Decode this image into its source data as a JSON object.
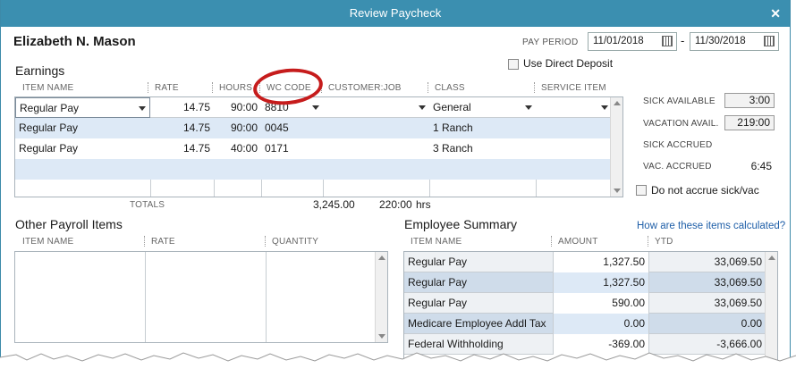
{
  "window": {
    "title": "Review Paycheck"
  },
  "employee": {
    "name": "Elizabeth N. Mason"
  },
  "pay_period": {
    "label": "PAY PERIOD",
    "from": "11/01/2018",
    "dash": "-",
    "to": "11/30/2018"
  },
  "direct_deposit": {
    "label": "Use Direct Deposit",
    "checked": false
  },
  "earnings": {
    "title": "Earnings",
    "headers": [
      "ITEM NAME",
      "RATE",
      "HOURS",
      "WC CODE",
      "CUSTOMER:JOB",
      "CLASS",
      "SERVICE ITEM"
    ],
    "rows": [
      {
        "item": "Regular Pay",
        "rate": "14.75",
        "hours": "90:00",
        "wc": "8810",
        "job": "",
        "class": "General",
        "service": ""
      },
      {
        "item": "Regular Pay",
        "rate": "14.75",
        "hours": "90:00",
        "wc": "0045",
        "job": "",
        "class": "1 Ranch",
        "service": ""
      },
      {
        "item": "Regular Pay",
        "rate": "14.75",
        "hours": "40:00",
        "wc": "0171",
        "job": "",
        "class": "3 Ranch",
        "service": ""
      }
    ],
    "totals": {
      "label": "TOTALS",
      "amount": "3,245.00",
      "hours": "220:00",
      "unit": "hrs"
    }
  },
  "sick_vacation": {
    "sick_available": {
      "label": "SICK AVAILABLE",
      "value": "3:00"
    },
    "vacation_avail": {
      "label": "VACATION AVAIL.",
      "value": "219:00"
    },
    "sick_accrued": {
      "label": "SICK ACCRUED",
      "value": ""
    },
    "vac_accrued": {
      "label": "VAC. ACCRUED",
      "value": "6:45"
    },
    "do_not_accrue": {
      "label": "Do not accrue sick/vac",
      "checked": false
    }
  },
  "other_payroll": {
    "title": "Other Payroll Items",
    "headers": [
      "ITEM NAME",
      "RATE",
      "QUANTITY"
    ]
  },
  "employee_summary": {
    "title": "Employee Summary",
    "help_link": "How are these items calculated?",
    "headers": [
      "ITEM NAME",
      "AMOUNT",
      "YTD"
    ],
    "rows": [
      {
        "item": "Regular Pay",
        "amount": "1,327.50",
        "ytd": "33,069.50"
      },
      {
        "item": "Regular Pay",
        "amount": "1,327.50",
        "ytd": "33,069.50"
      },
      {
        "item": "Regular Pay",
        "amount": "590.00",
        "ytd": "33,069.50"
      },
      {
        "item": "Medicare Employee Addl Tax",
        "amount": "0.00",
        "ytd": "0.00"
      },
      {
        "item": "Federal Withholding",
        "amount": "-369.00",
        "ytd": "-3,666.00"
      }
    ]
  },
  "colors": {
    "titlebar": "#3b8fb0",
    "row_highlight": "#dde9f6",
    "annotation_circle": "#c61c1c",
    "link": "#1f5fa8"
  }
}
